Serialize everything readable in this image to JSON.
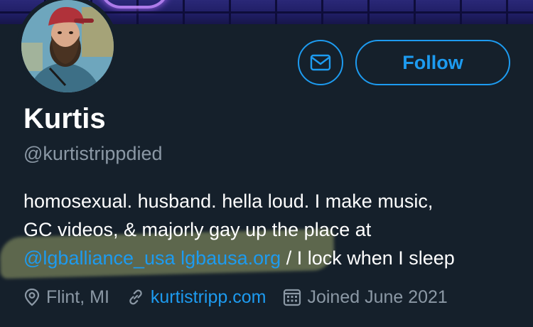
{
  "profile": {
    "display_name": "Kurtis",
    "handle": "@kurtistrippdied",
    "bio": {
      "line1": "homosexual. husband. hella loud. I make music,",
      "line2": "GC videos, & majorly gay up the place at",
      "mention": "@lgballiance_usa",
      "url": "lgbausa.org",
      "line3_rest": " / I lock when I sleep"
    },
    "location": "Flint, MI",
    "website": "kurtistripp.com",
    "joined": "Joined June 2021"
  },
  "actions": {
    "follow_label": "Follow"
  },
  "icons": {
    "message": "envelope-icon",
    "location": "location-pin-icon",
    "website": "link-icon",
    "joined": "calendar-icon"
  },
  "colors": {
    "background": "#15202b",
    "accent": "#1d9bf0",
    "secondary_text": "#8b98a5",
    "primary_text": "#ffffff"
  }
}
